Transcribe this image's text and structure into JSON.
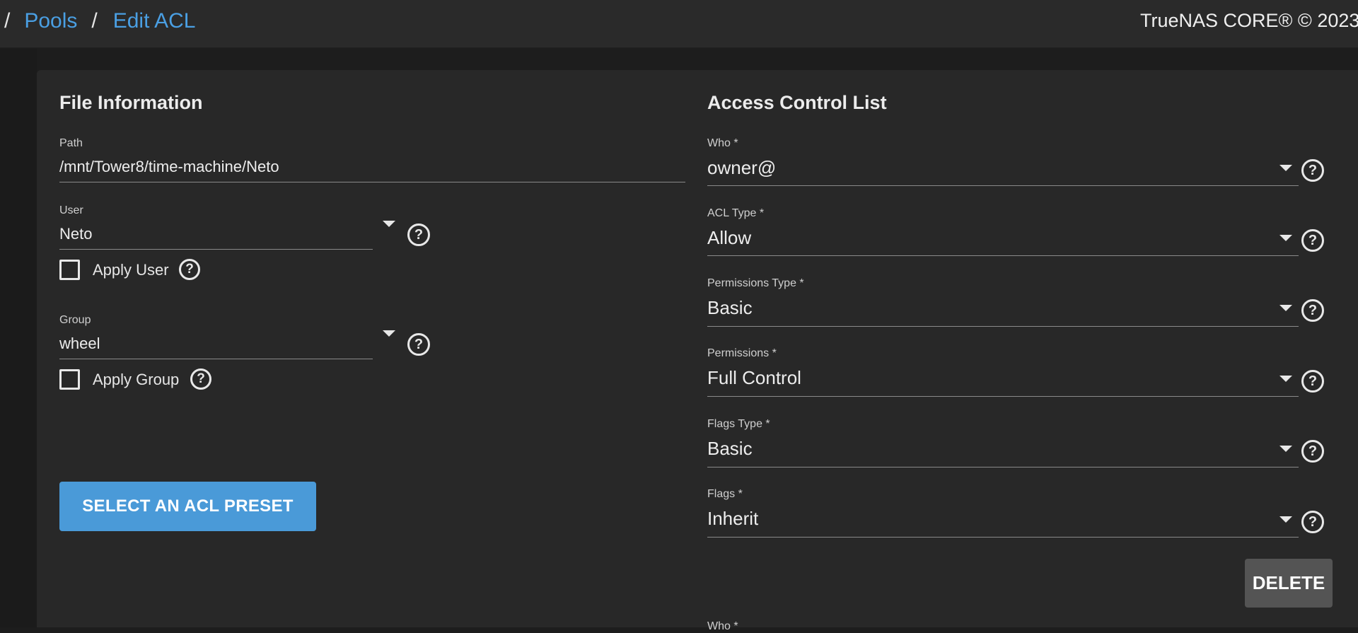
{
  "breadcrumb": {
    "sep": "/",
    "items": [
      "Pools",
      "Edit ACL"
    ]
  },
  "header": {
    "copyright": "TrueNAS CORE® © 2023 "
  },
  "file_info": {
    "title": "File Information",
    "path": {
      "label": "Path",
      "value": "/mnt/Tower8/time-machine/Neto"
    },
    "user": {
      "label": "User",
      "value": "Neto",
      "apply_label": "Apply User",
      "apply_checked": false
    },
    "group": {
      "label": "Group",
      "value": "wheel",
      "apply_label": "Apply Group",
      "apply_checked": false
    },
    "preset_button": "SELECT AN ACL PRESET"
  },
  "acl": {
    "title": "Access Control List",
    "fields": [
      {
        "label": "Who *",
        "value": "owner@"
      },
      {
        "label": "ACL Type *",
        "value": "Allow"
      },
      {
        "label": "Permissions Type *",
        "value": "Basic"
      },
      {
        "label": "Permissions *",
        "value": "Full Control"
      },
      {
        "label": "Flags Type *",
        "value": "Basic"
      },
      {
        "label": "Flags *",
        "value": "Inherit"
      }
    ],
    "delete_button": "DELETE",
    "next_label": "Who *"
  },
  "icons": {
    "help": "help-circle-icon",
    "dropdown": "caret-down-icon",
    "checkbox": "checkbox-unchecked-icon"
  },
  "colors": {
    "accent": "#4a9fe3",
    "button": "#4a9ad8",
    "delete": "#545454",
    "background": "#1d1d1d",
    "card": "#282828"
  }
}
